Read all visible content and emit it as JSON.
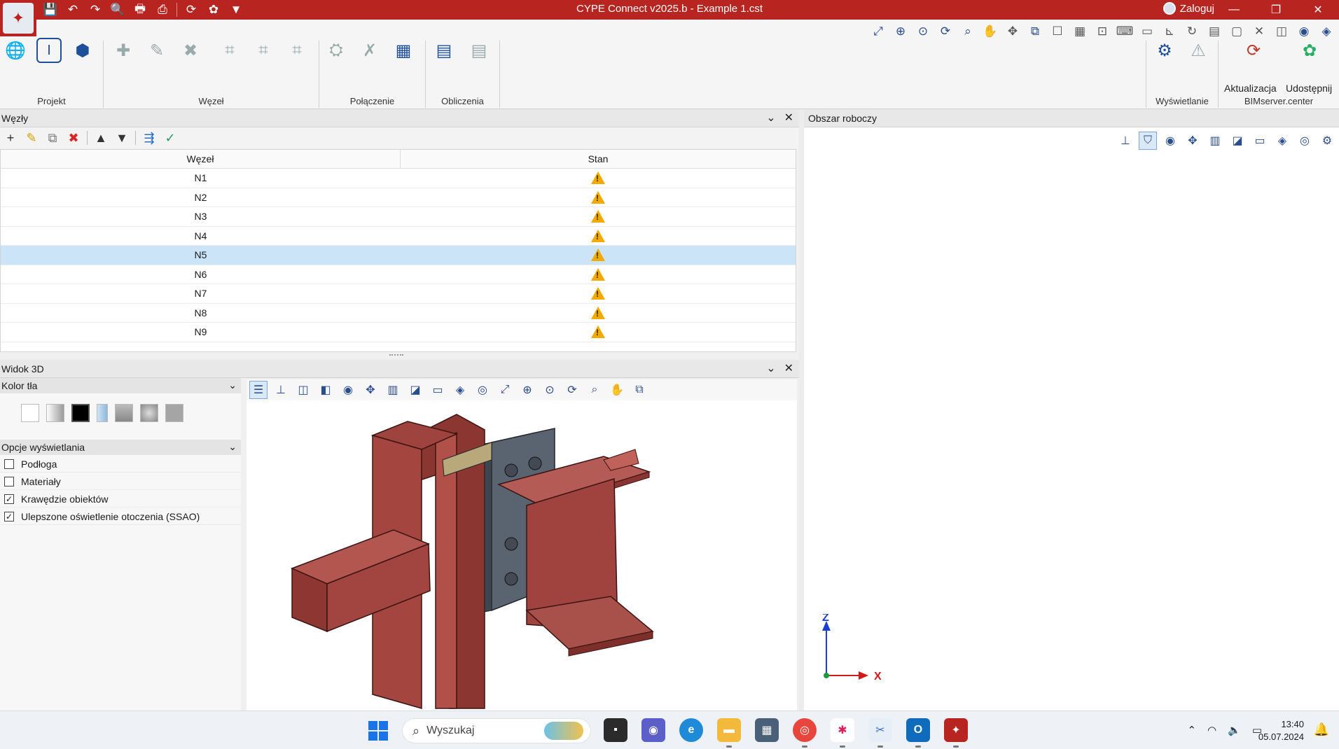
{
  "titlebar": {
    "title": "CYPE Connect v2025.b - Example 1.cst",
    "login": "Zaloguj",
    "minimize": "—",
    "restore": "❐",
    "close": "✕",
    "logo_letter": "✦"
  },
  "qat": {
    "save": "💾",
    "undo": "↶",
    "redo": "↷",
    "search": "🔍",
    "print": "🖶",
    "print2": "⎙",
    "refresh": "⟳",
    "share": "✿",
    "more": "▼"
  },
  "ribbon": {
    "groups": {
      "projekt": "Projekt",
      "wezel": "Węzeł",
      "polaczenie": "Połączenie",
      "obliczenia": "Obliczenia",
      "wyswietlanie": "Wyświetlanie",
      "bimserver": "BIMserver.center"
    },
    "aktualizacja": "Aktualizacja",
    "udostepnij": "Udostępnij"
  },
  "nodes_panel": {
    "title": "Węzły",
    "columns": {
      "node": "Węzeł",
      "state": "Stan"
    },
    "rows": [
      {
        "node": "N1",
        "selected": false
      },
      {
        "node": "N2",
        "selected": false
      },
      {
        "node": "N3",
        "selected": false
      },
      {
        "node": "N4",
        "selected": false
      },
      {
        "node": "N5",
        "selected": true
      },
      {
        "node": "N6",
        "selected": false
      },
      {
        "node": "N7",
        "selected": false
      },
      {
        "node": "N8",
        "selected": false
      },
      {
        "node": "N9",
        "selected": false
      }
    ]
  },
  "view3d": {
    "title": "Widok 3D",
    "bg_section": "Kolor tła",
    "display_section": "Opcje wyświetlania",
    "options": [
      {
        "label": "Podłoga",
        "checked": false
      },
      {
        "label": "Materiały",
        "checked": false
      },
      {
        "label": "Krawędzie obiektów",
        "checked": true
      },
      {
        "label": "Ulepszone oświetlenie otoczenia (SSAO)",
        "checked": true
      }
    ]
  },
  "workarea": {
    "title": "Obszar roboczy",
    "axis_z": "Z",
    "axis_x": "X"
  },
  "taskbar": {
    "search_placeholder": "Wyszukaj",
    "time": "13:40",
    "date": "05.07.2024"
  },
  "colors": {
    "accent": "#b8241f",
    "steel": "#a0403c",
    "selection": "#cce4f7",
    "warning": "#f2a900"
  }
}
